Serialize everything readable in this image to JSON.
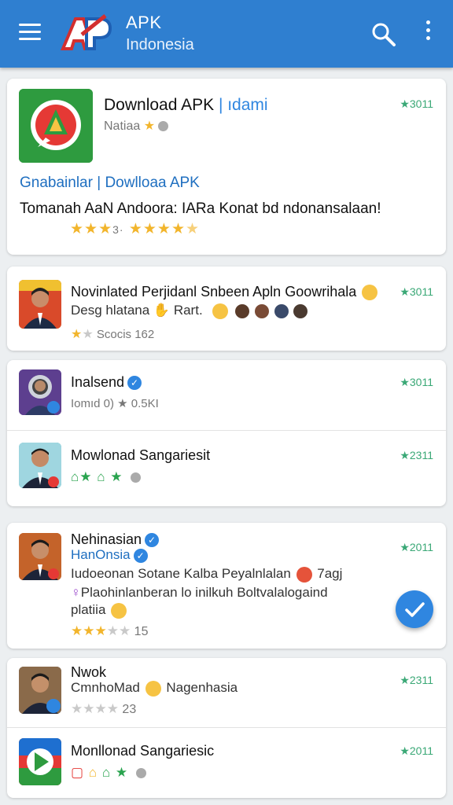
{
  "header": {
    "title": "APK",
    "subtitle": "Indonesia",
    "icons": [
      "menu-icon",
      "search-icon",
      "more-vert-icon"
    ]
  },
  "featured": {
    "title": "Download APK",
    "title_suffix": "| ıdami",
    "meta": "Natiaa",
    "rank": "★3011",
    "links": "Gnabainlar | Dowlloaa APK",
    "description": "Tomanah AaN Andoora: IARa Konat bd ndonansalaan!",
    "rating_label": "3·"
  },
  "items": [
    {
      "title": "Novinlated Perjidanl Snbeen Apln Goowrihala",
      "sub": "Desg hlatana",
      "sub2": "Rart.",
      "meta": "Scocis 162",
      "rank": "★3011"
    },
    {
      "title": "Inalsend",
      "meta": "Iomıd 0) ★ 0.5KI",
      "rank": "★3011"
    },
    {
      "title": "Mowlonad Sangariesit",
      "rank": "★2311"
    },
    {
      "title": "Nehinasian",
      "sub": "HanOnsia",
      "desc1": "Iudoeonan Sotane Kalba Peyalnlalan",
      "desc1_suffix": "7agj",
      "desc2": "Plaohinlanberan lo inilkuh Boltvalalogaind",
      "desc3": "platiia",
      "meta": "15",
      "rank": "★2011"
    },
    {
      "title": "Nwok",
      "sub": "CmnhoMad",
      "sub_suffix": "Nagenhasia",
      "meta": "23",
      "rank": "★2311"
    },
    {
      "title": "Monllonad Sangariesic",
      "rank": "★2011"
    }
  ],
  "fab": {
    "icon": "check-icon"
  },
  "colors": {
    "appbar": "#2f7fd0",
    "accent": "#2f86e0",
    "rank_green": "#3aa876",
    "star_gold": "#f2b52c"
  }
}
